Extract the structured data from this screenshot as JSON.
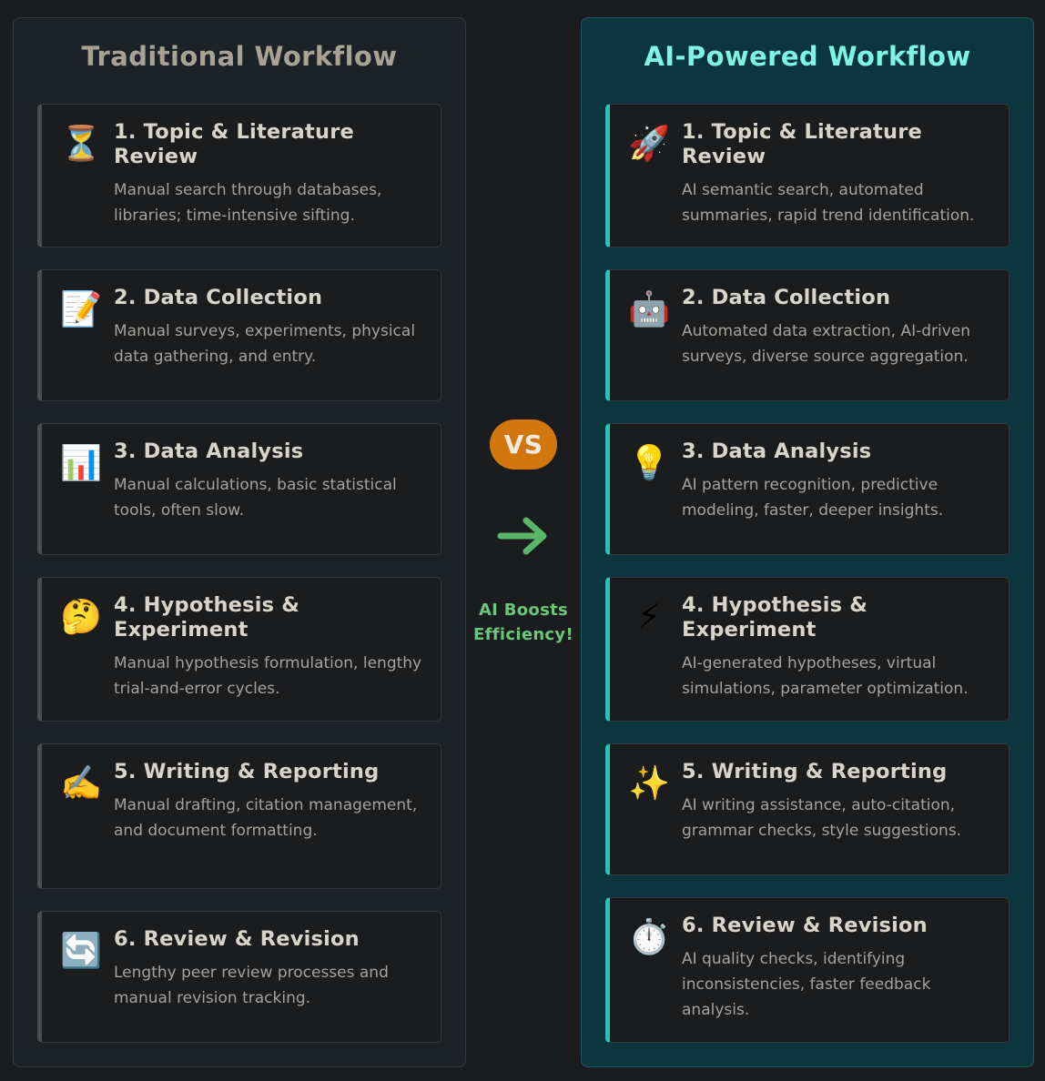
{
  "traditional": {
    "title": "Traditional Workflow",
    "steps": [
      {
        "icon": "⏳",
        "icon_name": "hourglass-icon",
        "title": "1. Topic & Literature Review",
        "desc": "Manual search through databases, libraries; time-intensive sifting."
      },
      {
        "icon": "📝",
        "icon_name": "memo-icon",
        "title": "2. Data Collection",
        "desc": "Manual surveys, experiments, physical data gathering, and entry."
      },
      {
        "icon": "📊",
        "icon_name": "bar-chart-icon",
        "title": "3. Data Analysis",
        "desc": "Manual calculations, basic statistical tools, often slow."
      },
      {
        "icon": "🤔",
        "icon_name": "thinking-face-icon",
        "title": "4. Hypothesis & Experiment",
        "desc": "Manual hypothesis formulation, lengthy trial-and-error cycles."
      },
      {
        "icon": "✍️",
        "icon_name": "writing-hand-icon",
        "title": "5. Writing & Reporting",
        "desc": "Manual drafting, citation management, and document formatting."
      },
      {
        "icon": "🔄",
        "icon_name": "cycle-arrows-icon",
        "title": "6. Review & Revision",
        "desc": "Lengthy peer review processes and manual revision tracking."
      }
    ]
  },
  "ai": {
    "title": "AI-Powered Workflow",
    "steps": [
      {
        "icon": "🚀",
        "icon_name": "rocket-icon",
        "title": "1. Topic & Literature Review",
        "desc": "AI semantic search, automated summaries, rapid trend identification."
      },
      {
        "icon": "🤖",
        "icon_name": "robot-icon",
        "title": "2. Data Collection",
        "desc": "Automated data extraction, AI-driven surveys, diverse source aggregation."
      },
      {
        "icon": "💡",
        "icon_name": "light-bulb-icon",
        "title": "3. Data Analysis",
        "desc": "AI pattern recognition, predictive modeling, faster, deeper insights."
      },
      {
        "icon": "⚡",
        "icon_name": "lightning-icon",
        "title": "4. Hypothesis & Experiment",
        "desc": "AI-generated hypotheses, virtual simulations, parameter optimization."
      },
      {
        "icon": "✨",
        "icon_name": "sparkles-icon",
        "title": "5. Writing & Reporting",
        "desc": "AI writing assistance, auto-citation, grammar checks, style suggestions."
      },
      {
        "icon": "⏱️",
        "icon_name": "stopwatch-icon",
        "title": "6. Review & Revision",
        "desc": "AI quality checks, identifying inconsistencies, faster feedback analysis."
      }
    ]
  },
  "center": {
    "vs_label": "VS",
    "boost_text": "AI Boosts Efficiency!",
    "arrow_icon": "right-arrow-icon"
  },
  "colors": {
    "traditional_accent": "#494e53",
    "ai_accent": "#1ec8b9",
    "ai_title": "#7ff3e6",
    "vs_badge": "#d2760e",
    "boost_text": "#6ac77a"
  }
}
